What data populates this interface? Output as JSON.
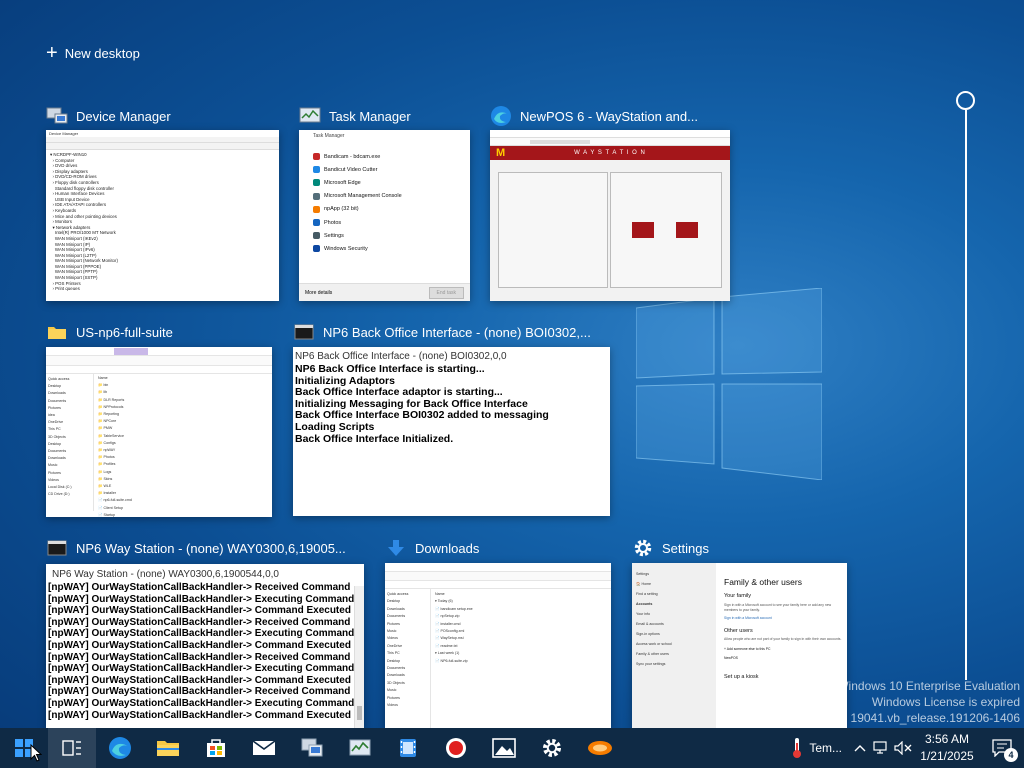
{
  "new_desktop": {
    "label": "New desktop"
  },
  "windows": {
    "device_manager": {
      "title": "Device Manager"
    },
    "task_manager": {
      "title": "Task Manager",
      "thumb_title": "Task Manager",
      "apps": [
        "Bandicam - bdcam.exe",
        "Bandicut Video Cutter",
        "Microsoft Edge",
        "Microsoft Management Console",
        "npApp (32 bit)",
        "Photos",
        "Settings",
        "Windows Security"
      ],
      "more_details": "More details",
      "end_task": "End task"
    },
    "newpos": {
      "title": "NewPOS 6 - WayStation and...",
      "header": "W A Y S T A T I O N"
    },
    "us_np6": {
      "title": "US-np6-full-suite"
    },
    "back_office": {
      "title": "NP6 Back Office Interface - (none) BOI0302,...",
      "thumb_title": "NP6 Back Office Interface - (none) BOI0302,0,0",
      "lines": [
        "NP6 Back Office Interface is starting...",
        "Initializing Adaptors",
        "Back Office Interface adaptor is starting...",
        "Initializing Messaging for Back Office Interface",
        "Back Office Interface BOI0302 added to messaging",
        "Loading Scripts",
        "Back Office Interface Initialized."
      ]
    },
    "way_station": {
      "title": "NP6 Way Station - (none) WAY0300,6,19005...",
      "thumb_title": "NP6 Way Station - (none) WAY0300,6,1900544,0,0",
      "lines": [
        "[npWAY] OurWayStationCallBackHandler-> Received Command",
        "[npWAY] OurWayStationCallBackHandler-> Executing Command",
        "[npWAY] OurWayStationCallBackHandler-> Command Executed",
        "[npWAY] OurWayStationCallBackHandler-> Received Command",
        "[npWAY] OurWayStationCallBackHandler-> Executing Command",
        "[npWAY] OurWayStationCallBackHandler-> Command Executed",
        "[npWAY] OurWayStationCallBackHandler-> Received Command",
        "[npWAY] OurWayStationCallBackHandler-> Executing Command",
        "[npWAY] OurWayStationCallBackHandler-> Command Executed",
        "[npWAY] OurWayStationCallBackHandler-> Received Command",
        "[npWAY] OurWayStationCallBackHandler-> Executing Command",
        "[npWAY] OurWayStationCallBackHandler-> Command Executed"
      ]
    },
    "downloads": {
      "title": "Downloads"
    },
    "settings": {
      "title": "Settings",
      "page_heading": "Family & other users",
      "your_family": "Your family",
      "other_users": "Other users",
      "setup_kiosk": "Set up a kiosk"
    }
  },
  "watermark": {
    "line1": "Windows 10 Enterprise Evaluation",
    "line2": "Windows License is expired",
    "line3": "Build 19041.vb_release.191206-1406"
  },
  "taskbar": {
    "weather_text": "Tem...",
    "time": "3:56 AM",
    "date": "1/21/2025",
    "notification_count": "4",
    "apps": [
      "start",
      "task-view",
      "edge",
      "file-explorer",
      "store",
      "mail",
      "device-manager",
      "task-manager",
      "newpos",
      "bandicam",
      "photos",
      "settings",
      "pos-app"
    ]
  },
  "colors": {
    "accent_blue": "#1565ad",
    "taskbar": "#0f2a45",
    "newpos_red": "#a4161a"
  }
}
